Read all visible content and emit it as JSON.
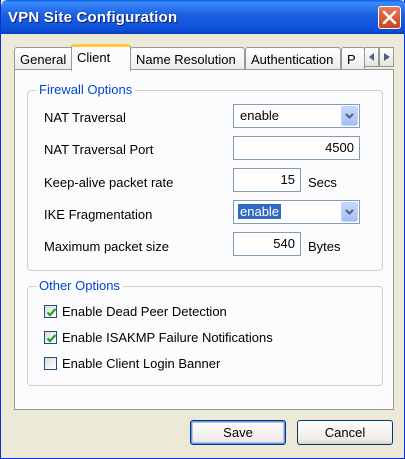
{
  "window": {
    "title": "VPN Site Configuration"
  },
  "tabs": [
    {
      "label": "General"
    },
    {
      "label": "Client"
    },
    {
      "label": "Name Resolution"
    },
    {
      "label": "Authentication"
    },
    {
      "label": "P"
    }
  ],
  "firewall": {
    "title": "Firewall Options",
    "nat_traversal": {
      "label": "NAT Traversal",
      "value": "enable"
    },
    "nat_port": {
      "label": "NAT Traversal Port",
      "value": "4500"
    },
    "keepalive": {
      "label": "Keep-alive packet rate",
      "value": "15",
      "unit": "Secs"
    },
    "ike_frag": {
      "label": "IKE Fragmentation",
      "value": "enable"
    },
    "max_packet": {
      "label": "Maximum packet size",
      "value": "540",
      "unit": "Bytes"
    }
  },
  "other": {
    "title": "Other Options",
    "options": [
      {
        "label": "Enable Dead Peer Detection",
        "checked": true
      },
      {
        "label": "Enable ISAKMP Failure Notifications",
        "checked": true
      },
      {
        "label": "Enable Client Login Banner",
        "checked": false
      }
    ]
  },
  "buttons": {
    "save": "Save",
    "cancel": "Cancel"
  }
}
